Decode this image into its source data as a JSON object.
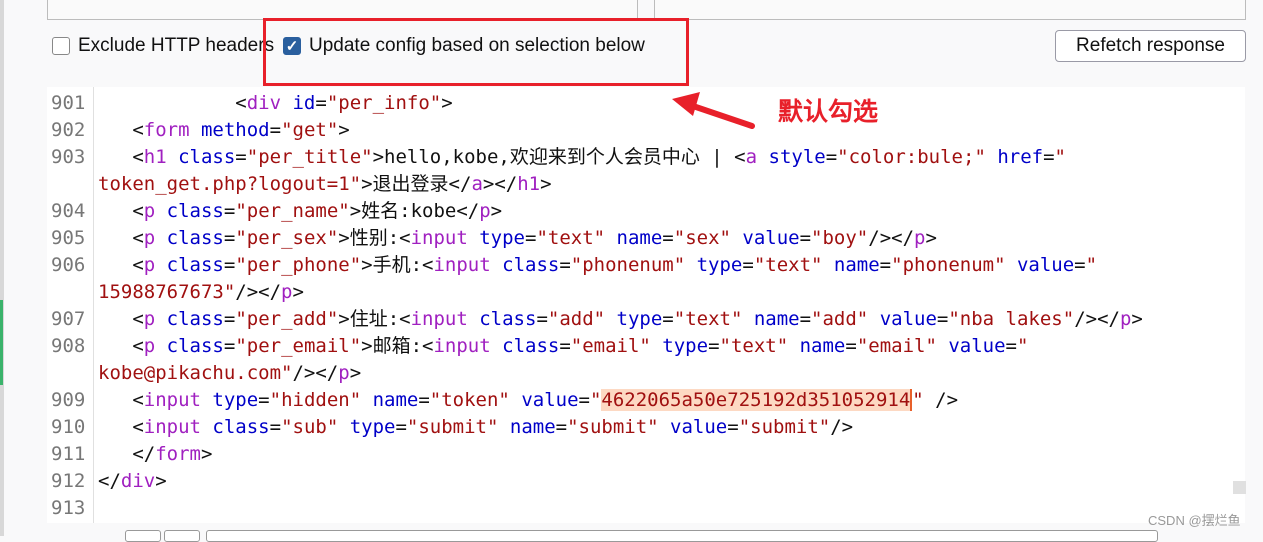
{
  "options": {
    "exclude_headers": {
      "label": "Exclude HTTP headers",
      "checked": false
    },
    "update_config": {
      "label": "Update config based on selection below",
      "checked": true
    },
    "refetch_label": "Refetch response"
  },
  "annotation": {
    "text": "默认勾选",
    "color": "#e8202a"
  },
  "watermark": "CSDN @摆烂鱼",
  "colors": {
    "tag": "#a020c0",
    "attr": "#0000c8",
    "value": "#a01010",
    "highlight": "#fdd9c3"
  },
  "code_rows": [
    {
      "ln": "901",
      "tokens": [
        [
          "p",
          "            <"
        ],
        [
          "t",
          "div"
        ],
        [
          "a",
          " id"
        ],
        [
          "p",
          "="
        ],
        [
          "v",
          "\"per_info\""
        ],
        [
          "p",
          ">"
        ]
      ]
    },
    {
      "ln": "902",
      "tokens": [
        [
          "p",
          "   <"
        ],
        [
          "t",
          "form"
        ],
        [
          "a",
          " method"
        ],
        [
          "p",
          "="
        ],
        [
          "v",
          "\"get\""
        ],
        [
          "p",
          ">"
        ]
      ]
    },
    {
      "ln": "903",
      "tokens": [
        [
          "p",
          "   <"
        ],
        [
          "t",
          "h1"
        ],
        [
          "a",
          " class"
        ],
        [
          "p",
          "="
        ],
        [
          "v",
          "\"per_title\""
        ],
        [
          "p",
          ">hello,kobe,欢迎来到个人会员中心 | <"
        ],
        [
          "t",
          "a"
        ],
        [
          "a",
          " style"
        ],
        [
          "p",
          "="
        ],
        [
          "v",
          "\"color:bule;\""
        ],
        [
          "a",
          " href"
        ],
        [
          "p",
          "="
        ],
        [
          "v",
          "\""
        ]
      ]
    },
    {
      "ln": "",
      "tokens": [
        [
          "v",
          "token_get.php?logout=1\""
        ],
        [
          "p",
          ">退出登录</"
        ],
        [
          "t",
          "a"
        ],
        [
          "p",
          "></"
        ],
        [
          "t",
          "h1"
        ],
        [
          "p",
          ">"
        ]
      ]
    },
    {
      "ln": "904",
      "tokens": [
        [
          "p",
          "   <"
        ],
        [
          "t",
          "p"
        ],
        [
          "a",
          " class"
        ],
        [
          "p",
          "="
        ],
        [
          "v",
          "\"per_name\""
        ],
        [
          "p",
          ">姓名:kobe</"
        ],
        [
          "t",
          "p"
        ],
        [
          "p",
          ">"
        ]
      ]
    },
    {
      "ln": "905",
      "tokens": [
        [
          "p",
          "   <"
        ],
        [
          "t",
          "p"
        ],
        [
          "a",
          " class"
        ],
        [
          "p",
          "="
        ],
        [
          "v",
          "\"per_sex\""
        ],
        [
          "p",
          ">性别:<"
        ],
        [
          "t",
          "input"
        ],
        [
          "a",
          " type"
        ],
        [
          "p",
          "="
        ],
        [
          "v",
          "\"text\""
        ],
        [
          "a",
          " name"
        ],
        [
          "p",
          "="
        ],
        [
          "v",
          "\"sex\""
        ],
        [
          "a",
          " value"
        ],
        [
          "p",
          "="
        ],
        [
          "v",
          "\"boy\""
        ],
        [
          "p",
          "/></"
        ],
        [
          "t",
          "p"
        ],
        [
          "p",
          ">"
        ]
      ]
    },
    {
      "ln": "906",
      "tokens": [
        [
          "p",
          "   <"
        ],
        [
          "t",
          "p"
        ],
        [
          "a",
          " class"
        ],
        [
          "p",
          "="
        ],
        [
          "v",
          "\"per_phone\""
        ],
        [
          "p",
          ">手机:<"
        ],
        [
          "t",
          "input"
        ],
        [
          "a",
          " class"
        ],
        [
          "p",
          "="
        ],
        [
          "v",
          "\"phonenum\""
        ],
        [
          "a",
          " type"
        ],
        [
          "p",
          "="
        ],
        [
          "v",
          "\"text\""
        ],
        [
          "a",
          " name"
        ],
        [
          "p",
          "="
        ],
        [
          "v",
          "\"phonenum\""
        ],
        [
          "a",
          " value"
        ],
        [
          "p",
          "="
        ],
        [
          "v",
          "\""
        ]
      ]
    },
    {
      "ln": "",
      "tokens": [
        [
          "v",
          "15988767673\""
        ],
        [
          "p",
          "/></"
        ],
        [
          "t",
          "p"
        ],
        [
          "p",
          ">"
        ]
      ]
    },
    {
      "ln": "907",
      "tokens": [
        [
          "p",
          "   <"
        ],
        [
          "t",
          "p"
        ],
        [
          "a",
          " class"
        ],
        [
          "p",
          "="
        ],
        [
          "v",
          "\"per_add\""
        ],
        [
          "p",
          ">住址:<"
        ],
        [
          "t",
          "input"
        ],
        [
          "a",
          " class"
        ],
        [
          "p",
          "="
        ],
        [
          "v",
          "\"add\""
        ],
        [
          "a",
          " type"
        ],
        [
          "p",
          "="
        ],
        [
          "v",
          "\"text\""
        ],
        [
          "a",
          " name"
        ],
        [
          "p",
          "="
        ],
        [
          "v",
          "\"add\""
        ],
        [
          "a",
          " value"
        ],
        [
          "p",
          "="
        ],
        [
          "v",
          "\"nba lakes\""
        ],
        [
          "p",
          "/></"
        ],
        [
          "t",
          "p"
        ],
        [
          "p",
          ">"
        ]
      ]
    },
    {
      "ln": "908",
      "tokens": [
        [
          "p",
          "   <"
        ],
        [
          "t",
          "p"
        ],
        [
          "a",
          " class"
        ],
        [
          "p",
          "="
        ],
        [
          "v",
          "\"per_email\""
        ],
        [
          "p",
          ">邮箱:<"
        ],
        [
          "t",
          "input"
        ],
        [
          "a",
          " class"
        ],
        [
          "p",
          "="
        ],
        [
          "v",
          "\"email\""
        ],
        [
          "a",
          " type"
        ],
        [
          "p",
          "="
        ],
        [
          "v",
          "\"text\""
        ],
        [
          "a",
          " name"
        ],
        [
          "p",
          "="
        ],
        [
          "v",
          "\"email\""
        ],
        [
          "a",
          " value"
        ],
        [
          "p",
          "="
        ],
        [
          "v",
          "\""
        ]
      ]
    },
    {
      "ln": "",
      "tokens": [
        [
          "v",
          "kobe@pikachu.com\""
        ],
        [
          "p",
          "/></"
        ],
        [
          "t",
          "p"
        ],
        [
          "p",
          ">"
        ]
      ]
    },
    {
      "ln": "909",
      "tokens": [
        [
          "p",
          "   <"
        ],
        [
          "t",
          "input"
        ],
        [
          "a",
          " type"
        ],
        [
          "p",
          "="
        ],
        [
          "v",
          "\"hidden\""
        ],
        [
          "a",
          " name"
        ],
        [
          "p",
          "="
        ],
        [
          "v",
          "\"token\""
        ],
        [
          "a",
          " value"
        ],
        [
          "p",
          "="
        ],
        [
          "v",
          "\""
        ],
        [
          "hl",
          "4622065a50e725192d351052914"
        ],
        [
          "v",
          "\""
        ],
        [
          "p",
          " />"
        ]
      ]
    },
    {
      "ln": "910",
      "tokens": [
        [
          "p",
          "   <"
        ],
        [
          "t",
          "input"
        ],
        [
          "a",
          " class"
        ],
        [
          "p",
          "="
        ],
        [
          "v",
          "\"sub\""
        ],
        [
          "a",
          " type"
        ],
        [
          "p",
          "="
        ],
        [
          "v",
          "\"submit\""
        ],
        [
          "a",
          " name"
        ],
        [
          "p",
          "="
        ],
        [
          "v",
          "\"submit\""
        ],
        [
          "a",
          " value"
        ],
        [
          "p",
          "="
        ],
        [
          "v",
          "\"submit\""
        ],
        [
          "p",
          "/>"
        ]
      ]
    },
    {
      "ln": "911",
      "tokens": [
        [
          "p",
          "   </"
        ],
        [
          "t",
          "form"
        ],
        [
          "p",
          ">"
        ]
      ]
    },
    {
      "ln": "912",
      "tokens": [
        [
          "p",
          "</"
        ],
        [
          "t",
          "div"
        ],
        [
          "p",
          ">"
        ]
      ]
    },
    {
      "ln": "913",
      "tokens": []
    }
  ]
}
